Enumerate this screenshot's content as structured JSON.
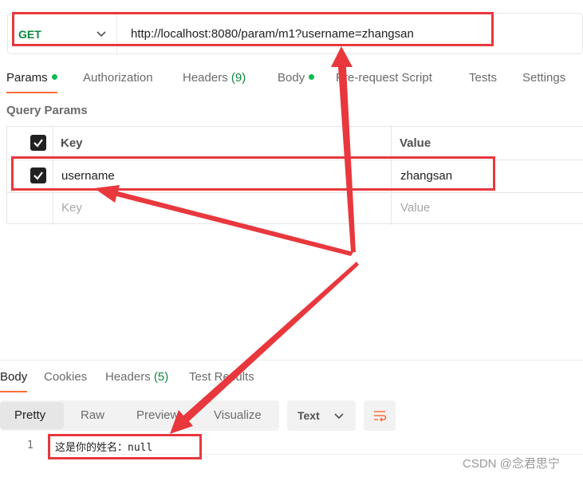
{
  "request": {
    "method": "GET",
    "url": "http://localhost:8080/param/m1?username=zhangsan"
  },
  "request_tabs": [
    {
      "label": "Params",
      "dot": true
    },
    {
      "label": "Authorization"
    },
    {
      "label": "Headers",
      "count": "(9)"
    },
    {
      "label": "Body",
      "dot": true
    },
    {
      "label": "Pre-request Script"
    },
    {
      "label": "Tests"
    },
    {
      "label": "Settings"
    }
  ],
  "query_params": {
    "title": "Query Params",
    "columns": {
      "key": "Key",
      "value": "Value"
    },
    "rows": [
      {
        "checked": true,
        "key": "username",
        "value": "zhangsan"
      }
    ],
    "placeholder": {
      "key": "Key",
      "value": "Value"
    }
  },
  "response_tabs": [
    {
      "label": "Body"
    },
    {
      "label": "Cookies"
    },
    {
      "label": "Headers",
      "count": "(5)"
    },
    {
      "label": "Test Results"
    }
  ],
  "response_formats": [
    "Pretty",
    "Raw",
    "Preview",
    "Visualize"
  ],
  "response_type": "Text",
  "response_body": {
    "line_number": "1",
    "text": "这是你的姓名：null"
  },
  "watermark": "CSDN @念君思宁",
  "colors": {
    "method_green": "#0b8a3d",
    "accent_orange": "#ff6c37",
    "annotation_red": "#e8383d"
  },
  "icons": {
    "method_dropdown": "chevron-down-icon",
    "param_checkbox": "checkbox-checked-icon",
    "type_dropdown": "chevron-down-icon",
    "wrap": "wrap-lines-icon"
  }
}
